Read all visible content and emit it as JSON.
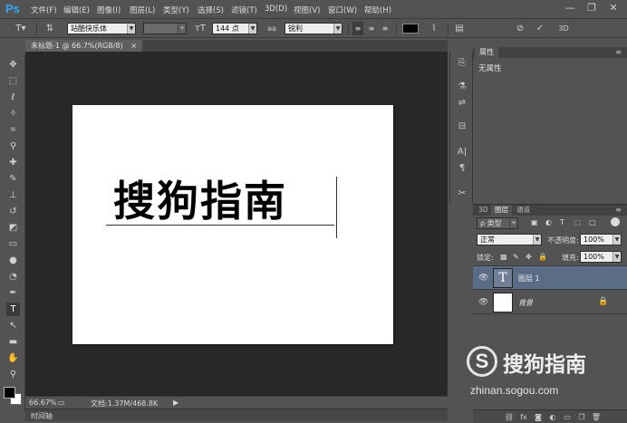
{
  "app": {
    "logo": "Ps"
  },
  "menu": [
    "文件(F)",
    "编辑(E)",
    "图像(I)",
    "图层(L)",
    "类型(Y)",
    "选择(S)",
    "滤镜(T)",
    "3D(D)",
    "视图(V)",
    "窗口(W)",
    "帮助(H)"
  ],
  "window_controls": {
    "minimize": "—",
    "restore": "❐",
    "close": "✕"
  },
  "options": {
    "font_family": "站酷快乐体",
    "font_style": "-",
    "font_size": "144 点",
    "aa_label": "aa",
    "antialias": "锐利",
    "three_d": "3D"
  },
  "document": {
    "tab_title": "未标题-1 @ 66.7%(RGB/8)",
    "tab_close": "×",
    "canvas_text": "搜狗指南"
  },
  "status": {
    "zoom": "66.67%",
    "doc_info": "文档:1.37M/468.8K",
    "timeline": "时间轴"
  },
  "properties": {
    "tab": "属性",
    "body": "无属性"
  },
  "layers_panel": {
    "tabs": [
      "3D",
      "图层",
      "通道"
    ],
    "filter_kind": "ρ 类型",
    "blend_mode": "正常",
    "opacity_label": "不透明度:",
    "opacity": "100%",
    "lock_label": "锁定:",
    "fill_label": "填充:",
    "fill": "100%",
    "layers": [
      {
        "name": "图层 1",
        "type": "text",
        "thumb": "T",
        "selected": true
      },
      {
        "name": "背景",
        "type": "background",
        "locked": true,
        "selected": false
      }
    ],
    "footer_icons": [
      "link-icon",
      "fx-icon",
      "mask-icon",
      "adjustment-icon",
      "group-icon",
      "new-layer-icon",
      "trash-icon"
    ],
    "footer_fx": "fx"
  },
  "watermark": {
    "logo": "S",
    "title": "搜狗指南",
    "url": "zhinan.sogou.com"
  }
}
